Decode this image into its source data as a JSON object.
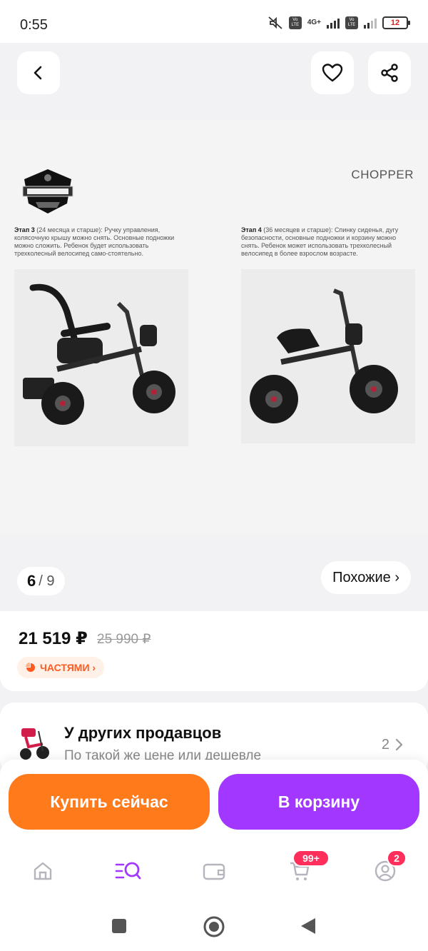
{
  "status": {
    "time": "0:55",
    "network": "4G+",
    "battery": "12"
  },
  "gallery": {
    "brand": "CHOPPER",
    "stage3": {
      "title": "Этап 3",
      "age": "(24 месяца и старше):",
      "text": "Ручку управления, колясочную крышу можно снять. Основные подножки можно сложить. Ребенок будет использовать трехколесный велосипед само-стоятельно."
    },
    "stage4": {
      "title": "Этап 4",
      "age": "(36 месяцев и старше):",
      "text": "Спинку сиденья, дугу безопасности, основные подножки и корзину можно снять. Ребенок может использовать трехколесный велосипед в более взрослом возрасте."
    },
    "current": "6",
    "total": "/ 9",
    "similar_label": "Похожие ›"
  },
  "price": {
    "current": "21 519 ₽",
    "old": "25 990 ₽",
    "installment": "ЧАСТЯМИ ›"
  },
  "sellers": {
    "title": "У других продавцов",
    "subtitle": "По такой же цене или дешевле",
    "count": "2"
  },
  "actions": {
    "buy_now": "Купить сейчас",
    "add_to_cart": "В корзину"
  },
  "nav": {
    "cart_badge": "99+",
    "profile_badge": "2"
  }
}
